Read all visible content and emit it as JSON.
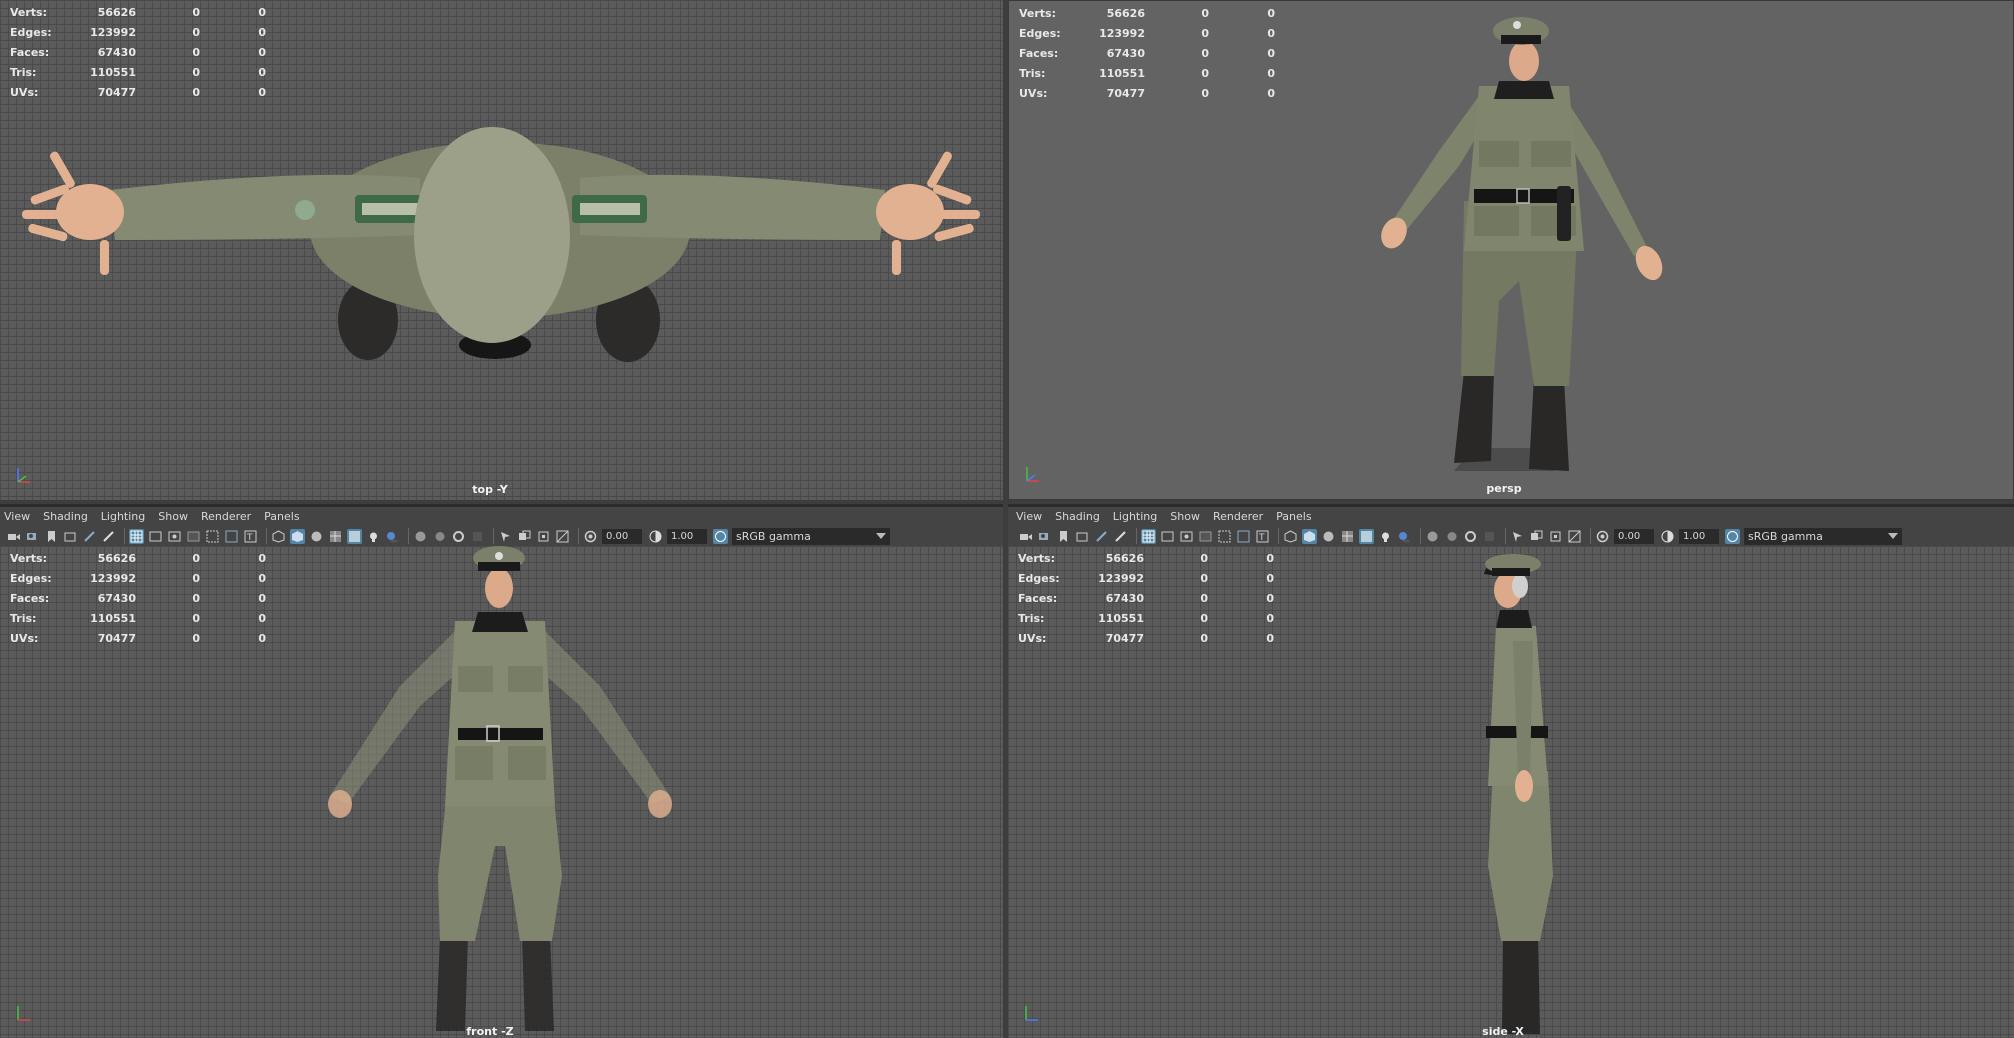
{
  "stats": {
    "rows": [
      {
        "label": "Verts:",
        "v1": "56626",
        "v2": "0",
        "v3": "0"
      },
      {
        "label": "Edges:",
        "v1": "123992",
        "v2": "0",
        "v3": "0"
      },
      {
        "label": "Faces:",
        "v1": "67430",
        "v2": "0",
        "v3": "0"
      },
      {
        "label": "Tris:",
        "v1": "110551",
        "v2": "0",
        "v3": "0"
      },
      {
        "label": "UVs:",
        "v1": "70477",
        "v2": "0",
        "v3": "0"
      }
    ]
  },
  "viewports": {
    "top": {
      "camera": "top -Y"
    },
    "persp": {
      "camera": "persp"
    },
    "front": {
      "camera": "front -Z"
    },
    "side": {
      "camera": "side -X"
    }
  },
  "menu": {
    "items": [
      "View",
      "Shading",
      "Lighting",
      "Show",
      "Renderer",
      "Panels"
    ]
  },
  "toolbar": {
    "exposure": "0.00",
    "gamma": "1.00",
    "color_space": "sRGB gamma"
  },
  "colors": {
    "viewport_bg": "#5b5b5b",
    "persp_bg": "#636363",
    "selection_blue": "#5285a6",
    "uniform_green": "#7f846d",
    "boot_black": "#2a2a2a",
    "skin": "#e8b89a"
  },
  "icons": [
    "camera-select-icon",
    "grid-icon",
    "wireframe-icon",
    "smooth-shade-icon",
    "textured-icon",
    "lighting-icon",
    "shadows-icon",
    "isolate-icon",
    "xray-icon",
    "exposure-icon",
    "gamma-icon",
    "color-space-icon"
  ]
}
